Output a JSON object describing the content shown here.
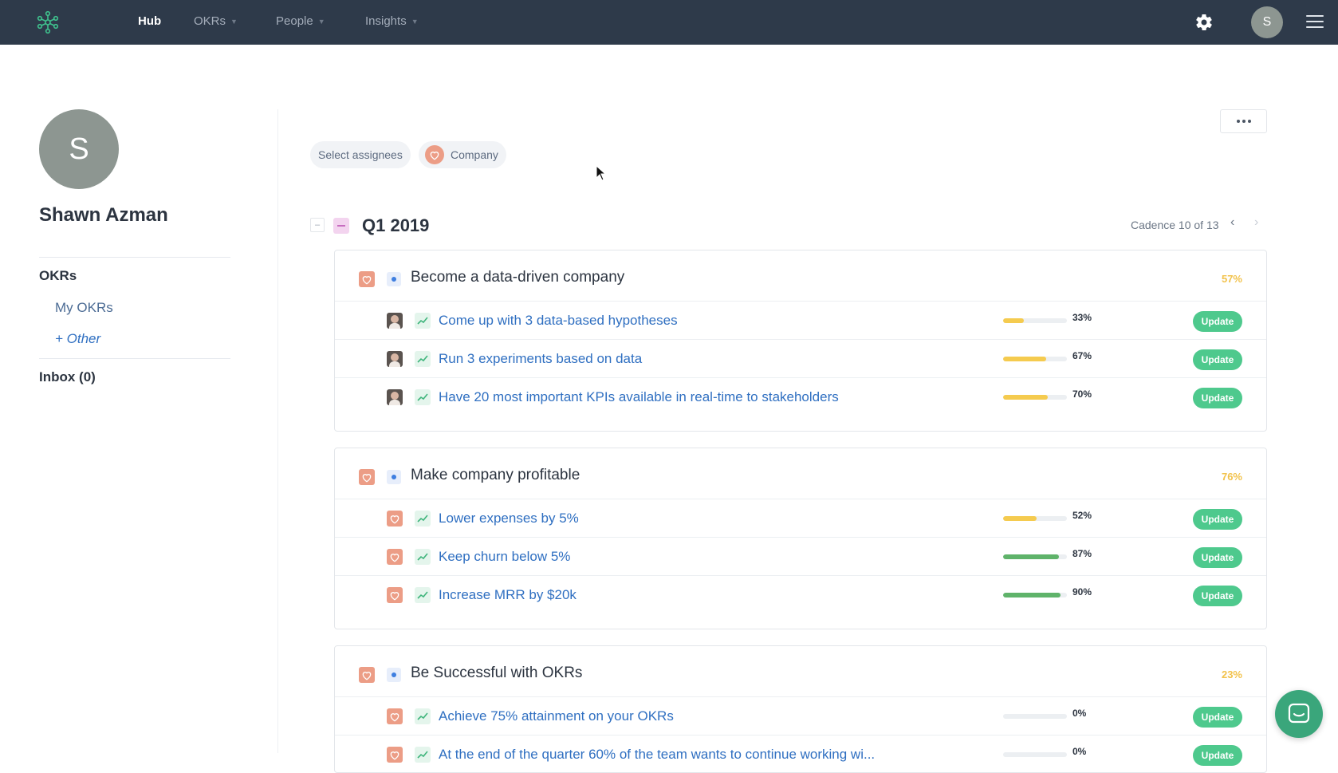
{
  "nav": {
    "items": [
      {
        "label": "Hub",
        "active": true
      },
      {
        "label": "OKRs",
        "active": false
      },
      {
        "label": "People",
        "active": false
      },
      {
        "label": "Insights",
        "active": false
      }
    ],
    "avatar_initial": "S",
    "icons": [
      "logo-icon",
      "gear-icon",
      "hamburger-icon"
    ]
  },
  "sidebar": {
    "avatar_initial": "S",
    "user_name": "Shawn Azman",
    "okrs_heading": "OKRs",
    "my_okrs": "My OKRs",
    "other": "+ Other",
    "inbox": "Inbox (0)"
  },
  "filters": {
    "assignees": "Select assignees",
    "company": "Company"
  },
  "cadence": {
    "title": "Q1 2019",
    "label": "Cadence 10 of 13",
    "prev": "‹",
    "next": "›"
  },
  "objectives": [
    {
      "title": "Become a data-driven company",
      "progress": "57%",
      "key_results": [
        {
          "title": "Come up with 3 data-based hypotheses",
          "progress": 33,
          "progress_label": "33%",
          "owner": "photo",
          "bar_color": "#f5cb4f"
        },
        {
          "title": "Run 3 experiments based on data",
          "progress": 67,
          "progress_label": "67%",
          "owner": "photo",
          "bar_color": "#f5cb4f"
        },
        {
          "title": "Have 20 most important KPIs available in real-time to stakeholders",
          "progress": 70,
          "progress_label": "70%",
          "owner": "photo",
          "bar_color": "#f5cb4f"
        }
      ]
    },
    {
      "title": "Make company profitable",
      "progress": "76%",
      "key_results": [
        {
          "title": "Lower expenses by 5%",
          "progress": 52,
          "progress_label": "52%",
          "owner": "company",
          "bar_color": "#f5cb4f"
        },
        {
          "title": "Keep churn below 5%",
          "progress": 87,
          "progress_label": "87%",
          "owner": "company",
          "bar_color": "#5fb36a"
        },
        {
          "title": "Increase MRR by $20k",
          "progress": 90,
          "progress_label": "90%",
          "owner": "company",
          "bar_color": "#5fb36a"
        }
      ]
    },
    {
      "title": "Be Successful with OKRs",
      "progress": "23%",
      "key_results": [
        {
          "title": "Achieve 75% attainment on your OKRs",
          "progress": 0,
          "progress_label": "0%",
          "owner": "company",
          "bar_color": "#f5cb4f"
        },
        {
          "title": "At the end of the quarter 60% of the team wants to continue working wi...",
          "progress": 0,
          "progress_label": "0%",
          "owner": "company",
          "bar_color": "#f5cb4f"
        }
      ]
    }
  ],
  "update_label": "Update",
  "colors": {
    "nav_bg": "#2e3a4a",
    "accent_green": "#4ec98d",
    "link_blue": "#2f6fc1",
    "progress_yellow": "#f2c24b",
    "heart_orange": "#ec9d86"
  }
}
